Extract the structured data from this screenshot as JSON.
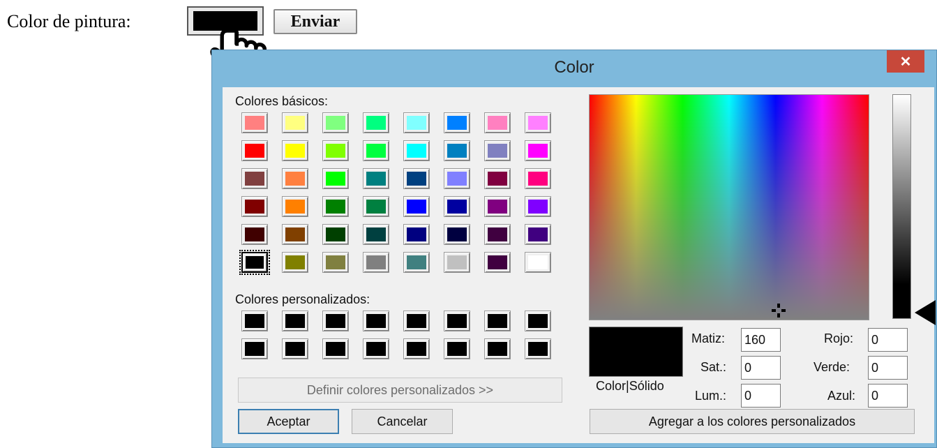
{
  "page": {
    "label": "Color de pintura:",
    "send_button": "Enviar",
    "input_color": "#000000"
  },
  "dialog": {
    "title": "Color",
    "close_symbol": "✕",
    "basic_colors_label": "Colores básicos:",
    "basic_colors": [
      [
        "#ff8080",
        "#ffff80",
        "#80ff80",
        "#00ff80",
        "#80ffff",
        "#0080ff",
        "#ff80c0",
        "#ff80ff"
      ],
      [
        "#ff0000",
        "#ffff00",
        "#80ff00",
        "#00ff40",
        "#00ffff",
        "#0080c0",
        "#8080c0",
        "#ff00ff"
      ],
      [
        "#804040",
        "#ff8040",
        "#00ff00",
        "#008080",
        "#004080",
        "#8080ff",
        "#800040",
        "#ff0080"
      ],
      [
        "#800000",
        "#ff8000",
        "#008000",
        "#008040",
        "#0000ff",
        "#0000a0",
        "#800080",
        "#8000ff"
      ],
      [
        "#400000",
        "#804000",
        "#004000",
        "#004040",
        "#000080",
        "#000040",
        "#400040",
        "#400080"
      ],
      [
        "#000000",
        "#808000",
        "#808040",
        "#808080",
        "#408080",
        "#c0c0c0",
        "#400040",
        "#ffffff"
      ]
    ],
    "selected_basic": "#000000",
    "custom_colors_label": "Colores personalizados:",
    "custom_colors": [
      [
        "#000000",
        "#000000",
        "#000000",
        "#000000",
        "#000000",
        "#000000",
        "#000000",
        "#000000"
      ],
      [
        "#000000",
        "#000000",
        "#000000",
        "#000000",
        "#000000",
        "#000000",
        "#000000",
        "#000000"
      ]
    ],
    "define_custom_button": "Definir colores personalizados >>",
    "accept_button": "Aceptar",
    "cancel_button": "Cancelar",
    "preview_label": "Color|Sólido",
    "preview_color": "#000000",
    "fields": {
      "hue_label": "Matiz:",
      "hue_value": "160",
      "sat_label": "Sat.:",
      "sat_value": "0",
      "lum_label": "Lum.:",
      "lum_value": "0",
      "red_label": "Rojo:",
      "red_value": "0",
      "green_label": "Verde:",
      "green_value": "0",
      "blue_label": "Azul:",
      "blue_value": "0"
    },
    "add_custom_button": "Agregar a los colores personalizados"
  }
}
